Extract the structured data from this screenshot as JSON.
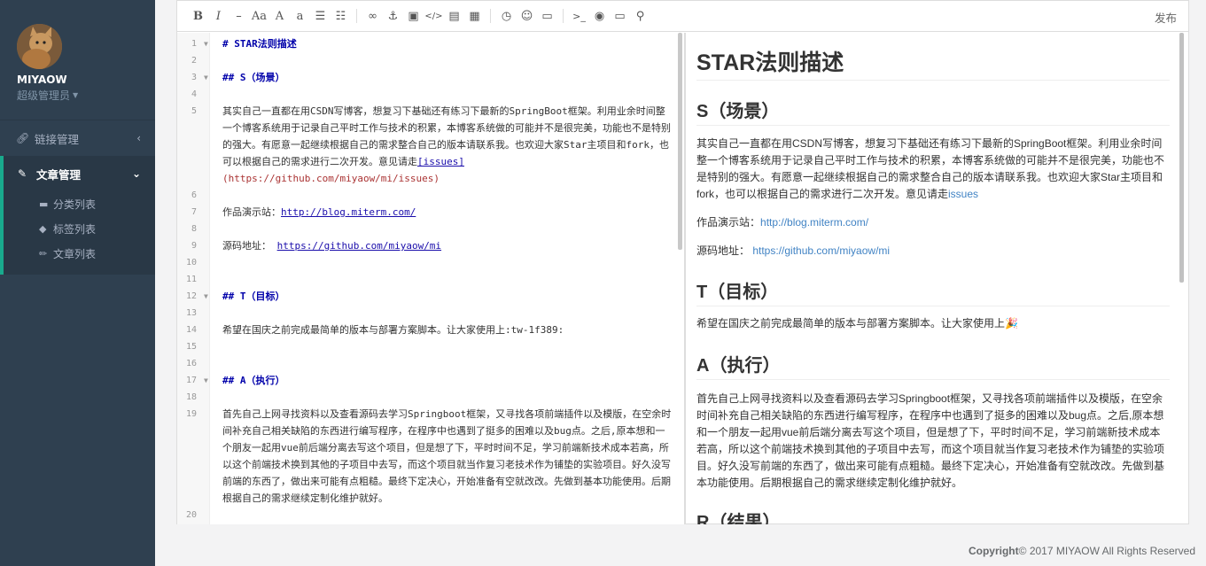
{
  "sidebar": {
    "user_name": "MIYAOW",
    "user_role": "超级管理员",
    "nav": [
      {
        "label": "链接管理",
        "icon": "link-icon"
      },
      {
        "label": "文章管理",
        "icon": "edit-icon"
      }
    ],
    "sub_items": [
      {
        "label": "分类列表",
        "icon": "folder-icon"
      },
      {
        "label": "标签列表",
        "icon": "tag-icon"
      },
      {
        "label": "文章列表",
        "icon": "pencil-icon"
      }
    ]
  },
  "toolbar": {
    "buttons": [
      "bold-icon",
      "italic-icon",
      "strikethrough-icon",
      "heading-icon",
      "uppercase-icon",
      "lowercase-icon",
      "unordered-list-icon",
      "ordered-list-icon",
      "link-icon",
      "anchor-icon",
      "image-icon",
      "code-icon",
      "code-block-icon",
      "table-icon",
      "datetime-icon",
      "emoji-icon",
      "html-entities-icon",
      "pagebreak-icon",
      "watch-icon",
      "preview-icon",
      "search-icon"
    ],
    "publish_label": "发布"
  },
  "code_lines": [
    {
      "n": "1",
      "fold": true,
      "text": "# STAR法则描述",
      "heading": true
    },
    {
      "n": "2",
      "fold": false,
      "text": "",
      "heading": false
    },
    {
      "n": "3",
      "fold": true,
      "text": "## S（场景）",
      "heading": true
    },
    {
      "n": "4",
      "fold": false,
      "text": "",
      "heading": false
    },
    {
      "n": "5",
      "fold": false,
      "text": "其实自己一直都在用CSDN写博客，想复习下基础还有练习下最新的SpringBoot框架。利用业余时间整一个博客系统用于记录自己平时工作与技术的积累，本博客系统做的可能并不是很完美，功能也不是特别的强大。有愿意一起继续根据自己的需求整合自己的版本请联系我。也欢迎大家Star主项目和fork，也可以根据自己的需求进行二次开发。意见请走",
      "heading": false
    },
    {
      "n": "6",
      "fold": false,
      "text": "",
      "heading": false
    },
    {
      "n": "7",
      "fold": false,
      "text": "作品演示站：",
      "heading": false
    },
    {
      "n": "8",
      "fold": false,
      "text": "",
      "heading": false
    },
    {
      "n": "9",
      "fold": false,
      "text": "源码地址： ",
      "heading": false
    },
    {
      "n": "10",
      "fold": false,
      "text": "",
      "heading": false
    },
    {
      "n": "11",
      "fold": false,
      "text": "",
      "heading": false
    },
    {
      "n": "12",
      "fold": true,
      "text": "## T（目标）",
      "heading": true
    },
    {
      "n": "13",
      "fold": false,
      "text": "",
      "heading": false
    },
    {
      "n": "14",
      "fold": false,
      "text": "希望在国庆之前完成最简单的版本与部署方案脚本。让大家使用上:tw-1f389:",
      "heading": false
    },
    {
      "n": "15",
      "fold": false,
      "text": "",
      "heading": false
    },
    {
      "n": "16",
      "fold": false,
      "text": "",
      "heading": false
    },
    {
      "n": "17",
      "fold": true,
      "text": "## A（执行）",
      "heading": true
    },
    {
      "n": "18",
      "fold": false,
      "text": "",
      "heading": false
    },
    {
      "n": "19",
      "fold": false,
      "text": "首先自己上网寻找资料以及查看源码去学习Springboot框架，又寻找各项前端插件以及模版，在空余时间补充自己相关缺陷的东西进行编写程序，在程序中也遇到了挺多的困难以及bug点。之后,原本想和一个朋友一起用vue前后端分离去写这个项目，但是想了下，平时时间不足，学习前端新技术成本若高，所以这个前端技术换到其他的子项目中去写，而这个项目就当作复习老技术作为铺垫的实验项目。好久没写前端的东西了，做出来可能有点粗糙。最终下定决心，开始准备有空就改改。先做到基本功能使用。后期根据自己的需求继续定制化维护就好。",
      "heading": false
    },
    {
      "n": "20",
      "fold": false,
      "text": "",
      "heading": false
    }
  ],
  "code_links": {
    "issues_text": "[issues]",
    "issues_url": "(https://github.com/miyaow/mi/issues)",
    "demo_url": "http://blog.miterm.com/",
    "source_url": "https://github.com/miyaow/mi"
  },
  "preview": {
    "h1": "STAR法则描述",
    "s_title": "S（场景）",
    "s_para": "其实自己一直都在用CSDN写博客，想复习下基础还有练习下最新的SpringBoot框架。利用业余时间整一个博客系统用于记录自己平时工作与技术的积累，本博客系统做的可能并不是很完美，功能也不是特别的强大。有愿意一起继续根据自己的需求整合自己的版本请联系我。也欢迎大家Star主项目和fork，也可以根据自己的需求进行二次开发。意见请走",
    "issues_link": "issues",
    "demo_label": "作品演示站：",
    "demo_link": "http://blog.miterm.com/",
    "source_label": "源码地址： ",
    "source_link": "https://github.com/miyaow/mi",
    "t_title": "T（目标）",
    "t_para": "希望在国庆之前完成最简单的版本与部署方案脚本。让大家使用上",
    "a_title": "A（执行）",
    "a_para": "首先自己上网寻找资料以及查看源码去学习Springboot框架，又寻找各项前端插件以及模版，在空余时间补充自己相关缺陷的东西进行编写程序，在程序中也遇到了挺多的困难以及bug点。之后,原本想和一个朋友一起用vue前后端分离去写这个项目，但是想了下，平时时间不足，学习前端新技术成本若高，所以这个前端技术换到其他的子项目中去写，而这个项目就当作复习老技术作为铺垫的实验项目。好久没写前端的东西了，做出来可能有点粗糙。最终下定决心，开始准备有空就改改。先做到基本功能使用。后期根据自己的需求继续定制化维护就好。",
    "r_title": "R（结果）"
  },
  "footer": {
    "bold": "Copyright",
    "rest": "© 2017 MIYAOW All Rights Reserved"
  }
}
